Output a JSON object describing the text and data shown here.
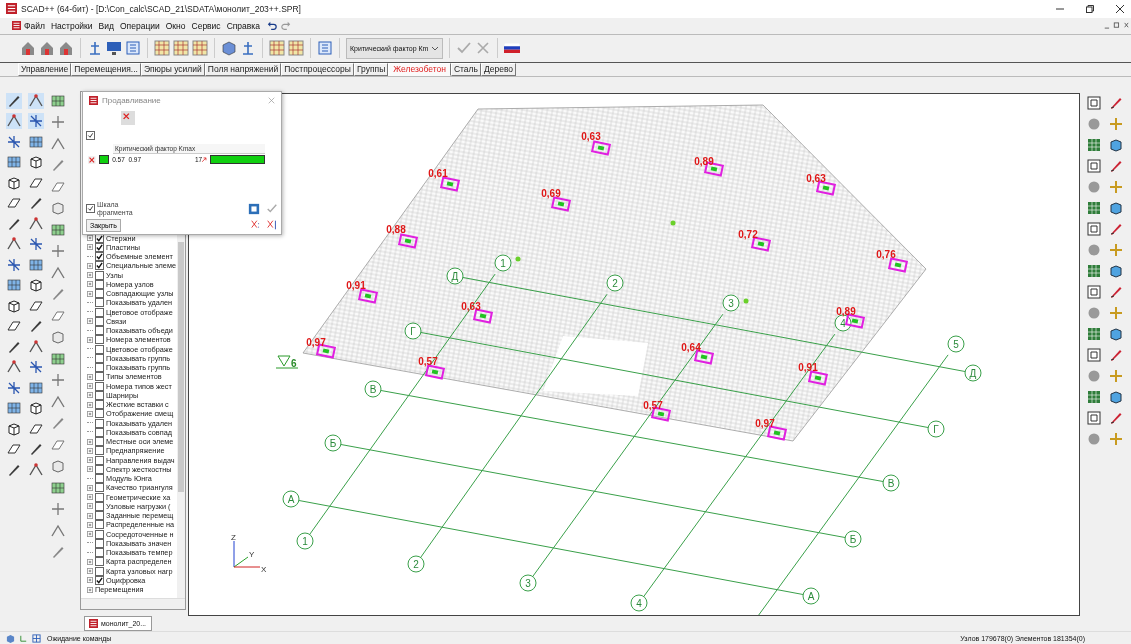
{
  "window": {
    "title": "SCAD++ (64-бит) - [D:\\Con_calc\\SCAD_21\\SDATA\\монолит_203++.SPR]"
  },
  "menu": [
    "Файл",
    "Настройки",
    "Вид",
    "Операции",
    "Окно",
    "Сервис",
    "Справка"
  ],
  "toolbar": {
    "dropdown": "Критический фактор Кm"
  },
  "tabs": [
    {
      "label": "Управление",
      "selected": false
    },
    {
      "label": "Перемещения...",
      "selected": false
    },
    {
      "label": "Эпюры усилий",
      "selected": false
    },
    {
      "label": "Поля напряжений",
      "selected": false
    },
    {
      "label": "Постпроцессоры",
      "selected": false
    },
    {
      "label": "Группы",
      "selected": false
    },
    {
      "label": "Железобетон",
      "selected": true
    },
    {
      "label": "Сталь",
      "selected": false
    },
    {
      "label": "Дерево",
      "selected": false
    }
  ],
  "dialog": {
    "title": "Продавливание",
    "show_all_checked": true,
    "column_header": "Критический фактор Kmax",
    "row": {
      "range": "0.57  0.97",
      "count": "17"
    },
    "scale": {
      "label": "Шкала фрагмента",
      "checked": true
    },
    "close_button": "Закрыть"
  },
  "tree": {
    "items": [
      {
        "label": "Стержни",
        "kind": "check",
        "has_children": true,
        "checked": true
      },
      {
        "label": "Пластины",
        "kind": "check",
        "has_children": true,
        "checked": true
      },
      {
        "label": "Объемные элемент",
        "kind": "check",
        "has_children": false,
        "checked": true
      },
      {
        "label": "Специальные элеме",
        "kind": "check",
        "has_children": true,
        "checked": true
      },
      {
        "label": "Узлы",
        "kind": "check",
        "has_children": true,
        "checked": false
      },
      {
        "label": "Номера узлов",
        "kind": "check",
        "has_children": true,
        "checked": false
      },
      {
        "label": "Совпадающие узлы",
        "kind": "check",
        "has_children": true,
        "checked": false
      },
      {
        "label": "Показывать удален",
        "kind": "check",
        "has_children": false,
        "checked": false
      },
      {
        "label": "Цветовое отображе",
        "kind": "check",
        "has_children": false,
        "checked": false
      },
      {
        "label": "Связи",
        "kind": "check",
        "has_children": true,
        "checked": false
      },
      {
        "label": "Показывать объеди",
        "kind": "check",
        "has_children": false,
        "checked": false
      },
      {
        "label": "Номера элементов",
        "kind": "check",
        "has_children": true,
        "checked": false
      },
      {
        "label": "Цветовое отображе",
        "kind": "check",
        "has_children": false,
        "checked": false
      },
      {
        "label": "Показывать группь",
        "kind": "check",
        "has_children": false,
        "checked": false
      },
      {
        "label": "Показывать группь",
        "kind": "check",
        "has_children": false,
        "checked": false
      },
      {
        "label": "Типы элементов",
        "kind": "check",
        "has_children": true,
        "checked": false
      },
      {
        "label": "Номера типов жест",
        "kind": "check",
        "has_children": true,
        "checked": false
      },
      {
        "label": "Шарниры",
        "kind": "check",
        "has_children": true,
        "checked": false
      },
      {
        "label": "Жесткие вставки с",
        "kind": "check",
        "has_children": true,
        "checked": false
      },
      {
        "label": "Отображение смещ",
        "kind": "check",
        "has_children": true,
        "checked": false
      },
      {
        "label": "Показывать удален",
        "kind": "check",
        "has_children": false,
        "checked": false
      },
      {
        "label": "Показывать совпад",
        "kind": "check",
        "has_children": false,
        "checked": false
      },
      {
        "label": "Местные оси элеме",
        "kind": "check",
        "has_children": true,
        "checked": false
      },
      {
        "label": "Преднапряжение",
        "kind": "check",
        "has_children": true,
        "checked": false
      },
      {
        "label": "Направления выдач",
        "kind": "check",
        "has_children": true,
        "checked": false
      },
      {
        "label": "Спектр жесткостны",
        "kind": "check",
        "has_children": true,
        "checked": false
      },
      {
        "label": "Модуль Юнга",
        "kind": "check",
        "has_children": false,
        "checked": false
      },
      {
        "label": "Качество триангуля",
        "kind": "check",
        "has_children": true,
        "checked": false
      },
      {
        "label": "Геометрические ха",
        "kind": "check",
        "has_children": true,
        "checked": false
      },
      {
        "label": "Узловые нагрузки (",
        "kind": "check",
        "has_children": true,
        "checked": false
      },
      {
        "label": "Заданные перемещ",
        "kind": "check",
        "has_children": true,
        "checked": false
      },
      {
        "label": "Распределенные на",
        "kind": "check",
        "has_children": true,
        "checked": false
      },
      {
        "label": "Сосредоточенные н",
        "kind": "check",
        "has_children": true,
        "checked": false
      },
      {
        "label": "Показывать значен",
        "kind": "check",
        "has_children": false,
        "checked": false
      },
      {
        "label": "Показывать темпер",
        "kind": "check",
        "has_children": false,
        "checked": false
      },
      {
        "label": "Карта распределен",
        "kind": "check",
        "has_children": true,
        "checked": false
      },
      {
        "label": "Карта узловых нагр",
        "kind": "check",
        "has_children": true,
        "checked": false
      },
      {
        "label": "Оцифровка",
        "kind": "check",
        "has_children": true,
        "checked": true
      },
      {
        "label": "Перемещения",
        "kind": "plain",
        "has_children": true
      }
    ]
  },
  "canvas": {
    "numbered_axes": [
      {
        "start": "1",
        "end": "1"
      },
      {
        "start": "2",
        "end": "2"
      },
      {
        "start": "3",
        "end": "3"
      },
      {
        "start": "4",
        "end": "4"
      },
      {
        "start": "5"
      }
    ],
    "lettered_axes": [
      {
        "start": "Д",
        "end": "Д"
      },
      {
        "start": "Г",
        "end": "Г"
      },
      {
        "start": "В",
        "end": "В"
      },
      {
        "start": "Б",
        "end": "Б"
      },
      {
        "start": "А",
        "end": "А"
      }
    ],
    "level_label": "6",
    "markers": [
      {
        "value": "0,63"
      },
      {
        "value": "0,89"
      },
      {
        "value": "0,61"
      },
      {
        "value": "0,69"
      },
      {
        "value": "0,63"
      },
      {
        "value": "0,88"
      },
      {
        "value": "0,72"
      },
      {
        "value": "0,76"
      },
      {
        "value": "0,91"
      },
      {
        "value": "0,63"
      },
      {
        "value": "0,89"
      },
      {
        "value": "0,97"
      },
      {
        "value": "0,57"
      },
      {
        "value": "0,64"
      },
      {
        "value": "0,91"
      },
      {
        "value": "0,57"
      },
      {
        "value": "0,97"
      }
    ],
    "triad": [
      "Z",
      "Y",
      "X"
    ]
  },
  "document_tab": "монолит_20...",
  "status_bar": {
    "message": "Ожидание команды",
    "counts": "Узлов 179678(0) Элементов 181354(0)"
  }
}
